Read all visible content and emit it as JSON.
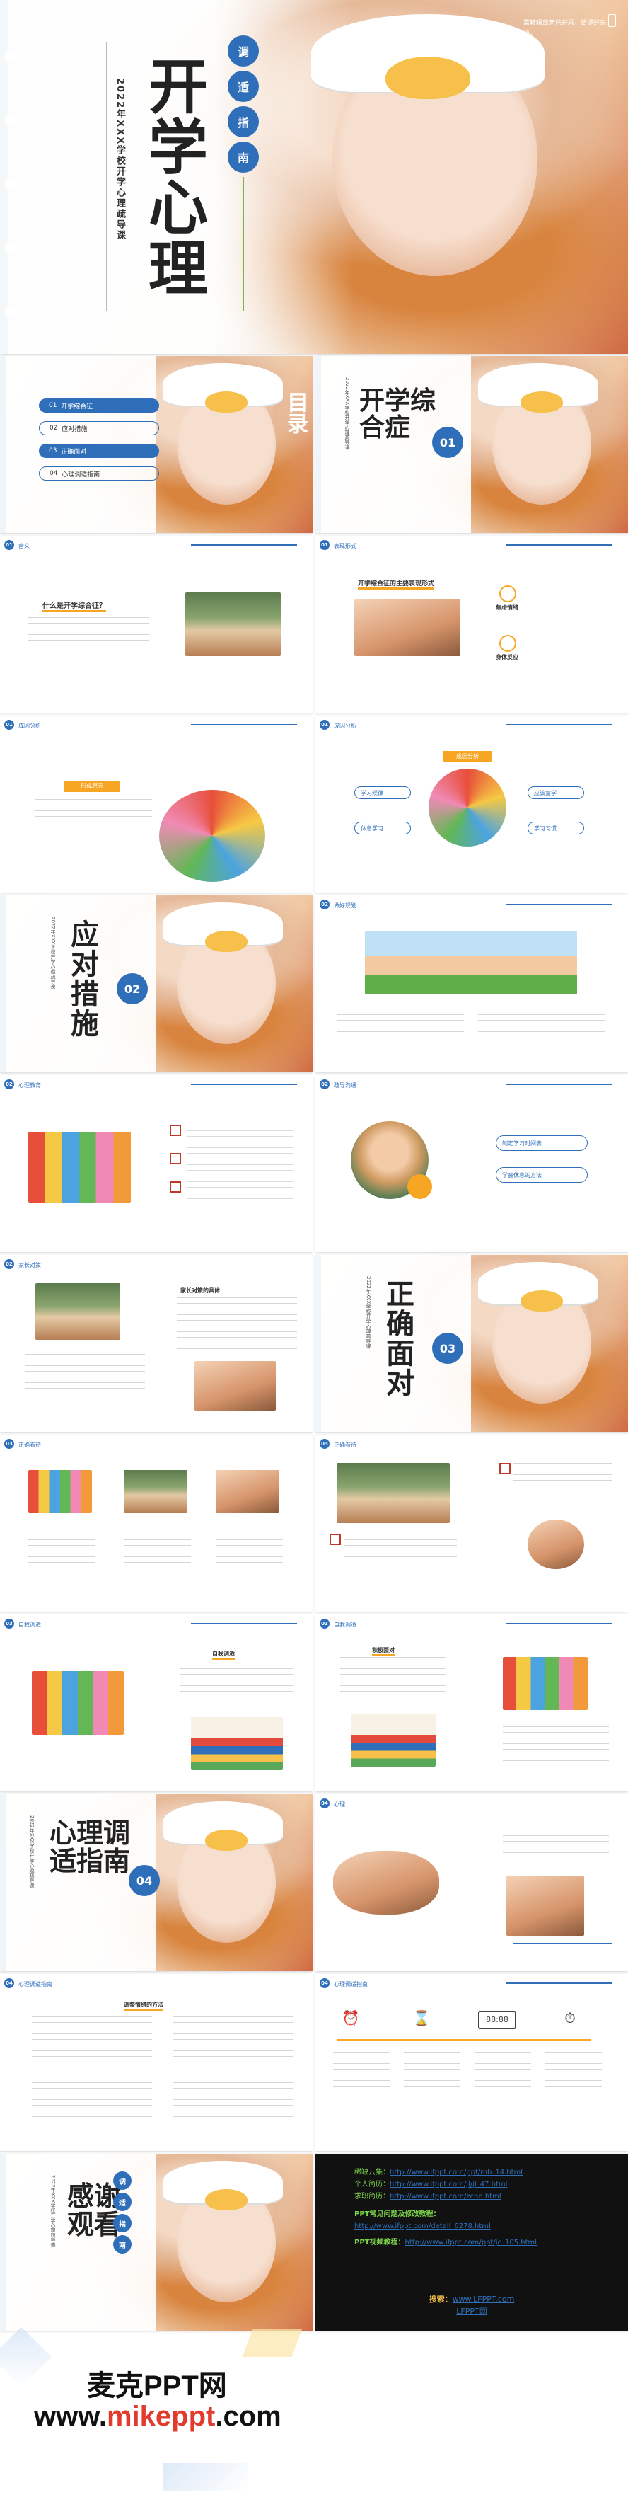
{
  "cover": {
    "tag_chars": [
      "调",
      "适",
      "指",
      "南"
    ],
    "title_chars": [
      "开",
      "学",
      "心",
      "理"
    ],
    "subtitle": "2022年XXX学校开学心理疏导课",
    "quote": "需转眼离新已开采，请提好先道。"
  },
  "slides": {
    "toc": {
      "side_label": "目录",
      "items": [
        "开学综合征",
        "应对措施",
        "正确面对",
        "心理调适指南"
      ],
      "nums": [
        "01",
        "02",
        "03",
        "04"
      ]
    },
    "sec1": {
      "title": "开学综合症",
      "num": "01",
      "sub": "2022年XXX学校开学心理疏导课"
    },
    "s_what": {
      "label": "含义",
      "q": "什么是开学综合征？"
    },
    "s_trait": {
      "label": "表现形式",
      "q": "开学综合征的主要表现形式",
      "items": [
        "焦虑情绪",
        "身体反应"
      ]
    },
    "s_reason1": {
      "label": "成因分析",
      "box": "形成原因"
    },
    "s_reason2": {
      "label": "成因分析",
      "box": "成因分析",
      "chips": [
        "学习规律",
        "休息学习",
        "应该复学",
        "学习习惯"
      ]
    },
    "sec2": {
      "title": "应对措施",
      "num": "02",
      "sub": "2022年XXX学校开学心理疏导课"
    },
    "s_adjust": {
      "label": "做好规划"
    },
    "s_mind": {
      "label": "心理教育"
    },
    "s_talk": {
      "label": "疏导沟通",
      "chips": [
        "制定学习时间表",
        "学会休息的方法"
      ]
    },
    "s_kind": {
      "label": "家长对策",
      "head": "家长对策的具体"
    },
    "sec3": {
      "title": "正确面对",
      "num": "03",
      "sub": "2022年XXX学校开学心理疏导课"
    },
    "s_face": {
      "label": "正确看待"
    },
    "s_self": {
      "label": "正确看待"
    },
    "s_fit1": {
      "label": "自我调适",
      "box": "自我调适"
    },
    "s_fit2": {
      "label": "自我调适",
      "box": "积极面对"
    },
    "sec4": {
      "title": "心理调适指南",
      "num": "04",
      "sub": "2022年XXX学校开学心理疏导课"
    },
    "s_psy": {
      "label": "心理"
    },
    "s_guide1": {
      "label": "心理调适指南",
      "box": "调整情绪的方法"
    },
    "s_guide2": {
      "label": "心理调适指南",
      "icons": [
        "alarm-clock-icon",
        "hourglass-icon",
        "digital-clock-icon",
        "stopwatch-icon"
      ]
    },
    "thanks": {
      "tag_chars": [
        "调",
        "适",
        "指",
        "南"
      ],
      "title": "感谢观看",
      "sub": "2022年XXX学校开学心理疏导课"
    }
  },
  "resources": {
    "lines": [
      {
        "label": "稀缺云集：",
        "url": "http://www.ifppt.com/ppt/mb_14.html"
      },
      {
        "label": "个人简历：",
        "url": "http://www.ifppt.com/jl/jl_47.html"
      },
      {
        "label": "求职简历：",
        "url": "http://www.ifppt.com/zchb.html"
      }
    ],
    "tutorial_title": "PPT常见问题及修改教程：",
    "tutorial_url": "http://www.ifppt.com/detail_6278.html",
    "video_label": "PPT视频教程：",
    "video_url": "http://www.ifppt.com/ppt/jc_105.html",
    "search_label": "搜索：",
    "search_value": "www.LFPPT.com",
    "search_brand": "LFPPT网"
  },
  "footer": {
    "brand_cn": "麦克PPT网",
    "site_prefix": "www.",
    "site_accent": "mikeppt",
    "site_suffix": ".com"
  },
  "colors": {
    "accent": "#2f6fba",
    "orange": "#f6a623",
    "dark_panel": "#111111",
    "link_green": "#7cd44a"
  }
}
